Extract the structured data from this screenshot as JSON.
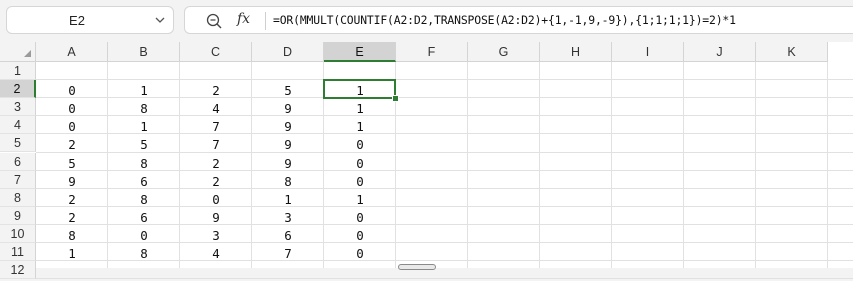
{
  "name_box": {
    "value": "E2"
  },
  "formula_bar": {
    "fx_label": "fx",
    "formula": "=OR(MMULT(COUNTIF(A2:D2,TRANSPOSE(A2:D2)+{1,-1,9,-9}),{1;1;1;1})=2)*1"
  },
  "columns": [
    "A",
    "B",
    "C",
    "D",
    "E",
    "F",
    "G",
    "H",
    "I",
    "J",
    "K"
  ],
  "selected_column": "E",
  "rows": [
    "1",
    "2",
    "3",
    "4",
    "5",
    "6",
    "7",
    "8",
    "9",
    "10",
    "11",
    "12"
  ],
  "selected_row": "2",
  "selected_cell": "E2",
  "cells": [
    [
      "",
      "",
      "",
      "",
      ""
    ],
    [
      "0",
      "1",
      "2",
      "5",
      "1"
    ],
    [
      "0",
      "8",
      "4",
      "9",
      "1"
    ],
    [
      "0",
      "1",
      "7",
      "9",
      "1"
    ],
    [
      "2",
      "5",
      "7",
      "9",
      "0"
    ],
    [
      "5",
      "8",
      "2",
      "9",
      "0"
    ],
    [
      "9",
      "6",
      "2",
      "8",
      "0"
    ],
    [
      "2",
      "8",
      "0",
      "1",
      "1"
    ],
    [
      "2",
      "6",
      "9",
      "3",
      "0"
    ],
    [
      "8",
      "0",
      "3",
      "6",
      "0"
    ],
    [
      "1",
      "8",
      "4",
      "7",
      "0"
    ],
    [
      "",
      "",
      "",
      "",
      ""
    ]
  ],
  "icons": {
    "namebox_dropdown": "chevron-down-icon",
    "zoom": "zoom-icon"
  }
}
